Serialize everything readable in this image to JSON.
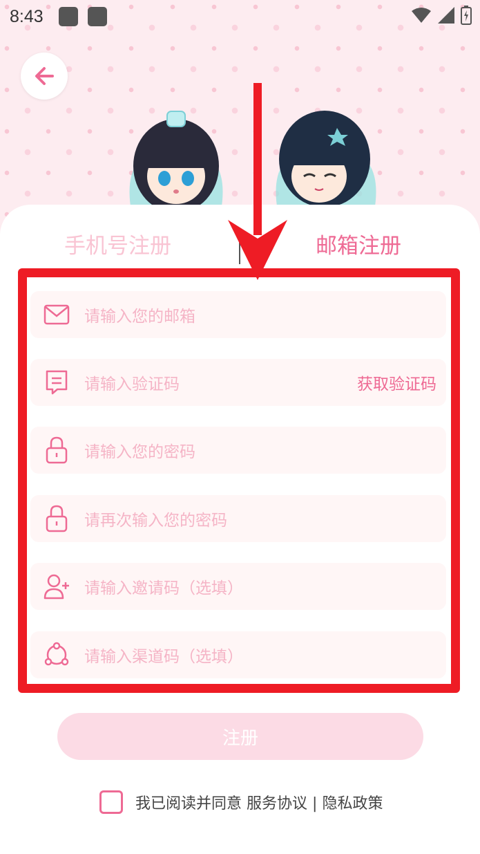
{
  "status_bar": {
    "time": "8:43"
  },
  "tabs": {
    "phone_label": "手机号注册",
    "email_label": "邮箱注册",
    "active": "email"
  },
  "fields": {
    "email_placeholder": "请输入您的邮箱",
    "code_placeholder": "请输入验证码",
    "get_code_label": "获取验证码",
    "password_placeholder": "请输入您的密码",
    "confirm_password_placeholder": "请再次输入您的密码",
    "invite_placeholder": "请输入邀请码（选填）",
    "channel_placeholder": "请输入渠道码（选填）"
  },
  "submit": {
    "label": "注册"
  },
  "agreement": {
    "prefix": "我已阅读并同意",
    "service_link": "服务协议",
    "separator": "|",
    "privacy_link": "隐私政策",
    "checked": false
  },
  "colors": {
    "accent": "#ee6a94",
    "accent_light": "#f5b4c6",
    "field_bg": "#fff6f6",
    "button_bg": "#fcdbe5",
    "annotation_red": "#ee1c25"
  },
  "icons": {
    "back": "arrow-left-icon",
    "email": "mail-icon",
    "code": "message-icon",
    "password": "lock-icon",
    "invite": "add-user-icon",
    "channel": "network-icon"
  }
}
